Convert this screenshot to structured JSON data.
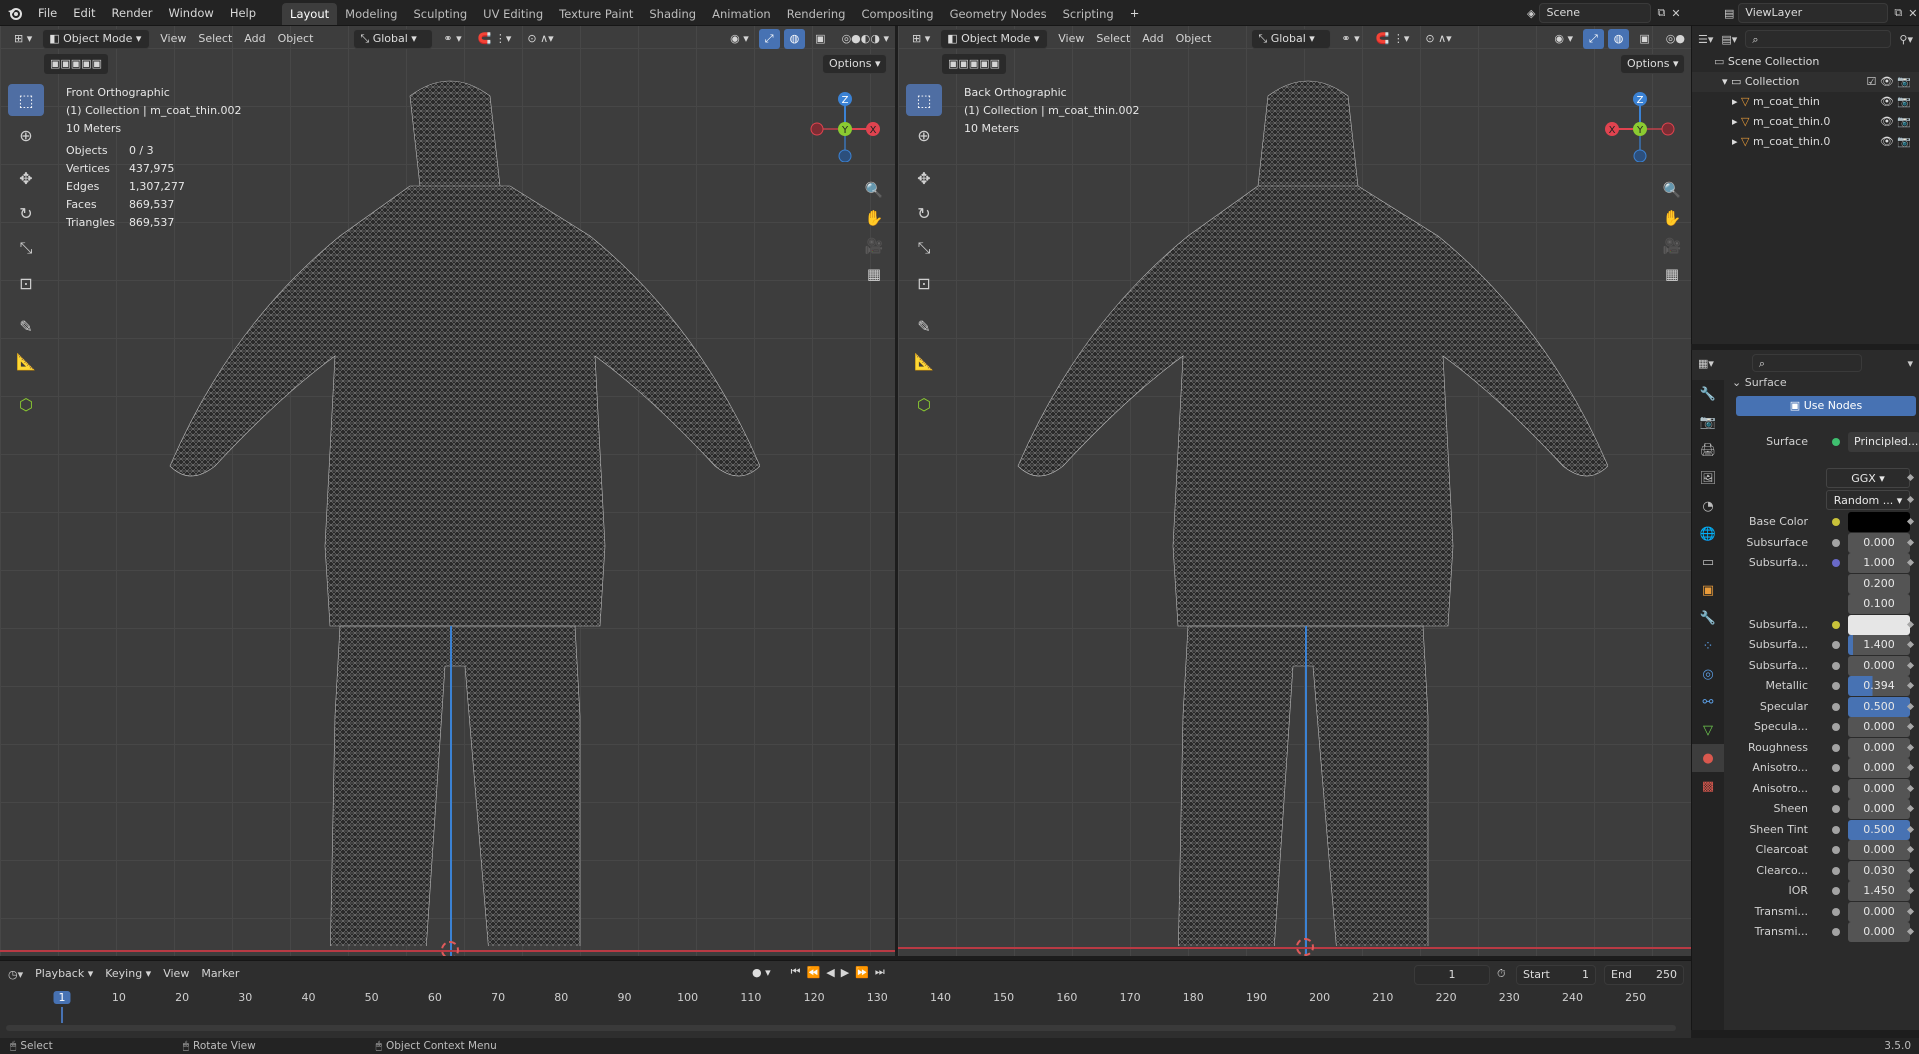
{
  "menus": [
    "File",
    "Edit",
    "Render",
    "Window",
    "Help"
  ],
  "workspaces": [
    "Layout",
    "Modeling",
    "Sculpting",
    "UV Editing",
    "Texture Paint",
    "Shading",
    "Animation",
    "Rendering",
    "Compositing",
    "Geometry Nodes",
    "Scripting"
  ],
  "active_workspace": "Layout",
  "scene_name": "Scene",
  "view_layer": "ViewLayer",
  "viewport_menus": [
    "View",
    "Select",
    "Add",
    "Object"
  ],
  "mode": "Object Mode",
  "orientation": "Global",
  "options_label": "Options",
  "left_viewport": {
    "view_name": "Front Orthographic",
    "collection_line": "(1) Collection | m_coat_thin.002",
    "scale_text": "10 Meters",
    "stats": [
      {
        "label": "Objects",
        "value": "0 / 3"
      },
      {
        "label": "Vertices",
        "value": "437,975"
      },
      {
        "label": "Edges",
        "value": "1,307,277"
      },
      {
        "label": "Faces",
        "value": "869,537"
      },
      {
        "label": "Triangles",
        "value": "869,537"
      }
    ]
  },
  "right_viewport": {
    "view_name": "Back Orthographic",
    "collection_line": "(1) Collection | m_coat_thin.002",
    "scale_text": "10 Meters"
  },
  "outliner": {
    "scene_collection": "Scene Collection",
    "collection": "Collection",
    "objects": [
      "m_coat_thin",
      "m_coat_thin.0",
      "m_coat_thin.0"
    ]
  },
  "properties": {
    "panel_title": "Surface",
    "use_nodes": "Use Nodes",
    "surface_label": "Surface",
    "surface_value": "Principled...",
    "distribution": "GGX",
    "subsurface_method": "Random ...",
    "rows": [
      {
        "label": "Base Color",
        "value": "",
        "dot": "#c9c23a",
        "kind": "color-black"
      },
      {
        "label": "Subsurface",
        "value": "0.000",
        "dot": "#a3a3a3",
        "fill": 0
      },
      {
        "label": "Subsurfa...",
        "value": "1.000",
        "dot": "#6a6ac8",
        "fill": 0
      },
      {
        "label": "",
        "value": "0.200",
        "dot": "",
        "fill": 0
      },
      {
        "label": "",
        "value": "0.100",
        "dot": "",
        "fill": 0
      },
      {
        "label": "Subsurfa...",
        "value": "",
        "dot": "#c9c23a",
        "kind": "color-white"
      },
      {
        "label": "Subsurfa...",
        "value": "1.400",
        "dot": "#a3a3a3",
        "fill": 8
      },
      {
        "label": "Subsurfa...",
        "value": "0.000",
        "dot": "#a3a3a3",
        "fill": 0
      },
      {
        "label": "Metallic",
        "value": "0.394",
        "dot": "#a3a3a3",
        "fill": 39.4
      },
      {
        "label": "Specular",
        "value": "0.500",
        "dot": "#a3a3a3",
        "fill": 100
      },
      {
        "label": "Specula...",
        "value": "0.000",
        "dot": "#a3a3a3",
        "fill": 0
      },
      {
        "label": "Roughness",
        "value": "0.000",
        "dot": "#a3a3a3",
        "fill": 0
      },
      {
        "label": "Anisotro...",
        "value": "0.000",
        "dot": "#a3a3a3",
        "fill": 0
      },
      {
        "label": "Anisotro...",
        "value": "0.000",
        "dot": "#a3a3a3",
        "fill": 0
      },
      {
        "label": "Sheen",
        "value": "0.000",
        "dot": "#a3a3a3",
        "fill": 0
      },
      {
        "label": "Sheen Tint",
        "value": "0.500",
        "dot": "#a3a3a3",
        "fill": 100
      },
      {
        "label": "Clearcoat",
        "value": "0.000",
        "dot": "#a3a3a3",
        "fill": 0
      },
      {
        "label": "Clearco...",
        "value": "0.030",
        "dot": "#a3a3a3",
        "fill": 0
      },
      {
        "label": "IOR",
        "value": "1.450",
        "dot": "#a3a3a3",
        "fill": 0
      },
      {
        "label": "Transmi...",
        "value": "0.000",
        "dot": "#a3a3a3",
        "fill": 0
      },
      {
        "label": "Transmi...",
        "value": "0.000",
        "dot": "#a3a3a3",
        "fill": 0
      }
    ]
  },
  "timeline": {
    "menus": [
      "Playback",
      "Keying",
      "View",
      "Marker"
    ],
    "current_frame": "1",
    "start_label": "Start",
    "start_value": "1",
    "end_label": "End",
    "end_value": "250",
    "ticks": [
      "1",
      "10",
      "20",
      "30",
      "40",
      "50",
      "60",
      "70",
      "80",
      "90",
      "100",
      "110",
      "120",
      "130",
      "140",
      "150",
      "160",
      "170",
      "180",
      "190",
      "200",
      "210",
      "220",
      "230",
      "240",
      "250"
    ]
  },
  "statusbar": {
    "select": "Select",
    "rotate": "Rotate View",
    "context": "Object Context Menu",
    "version": "3.5.0"
  },
  "colors": {
    "accent": "#4772b3",
    "axis_x": "#e0434f",
    "axis_y": "#8bcb31",
    "axis_z": "#3b82d4"
  }
}
